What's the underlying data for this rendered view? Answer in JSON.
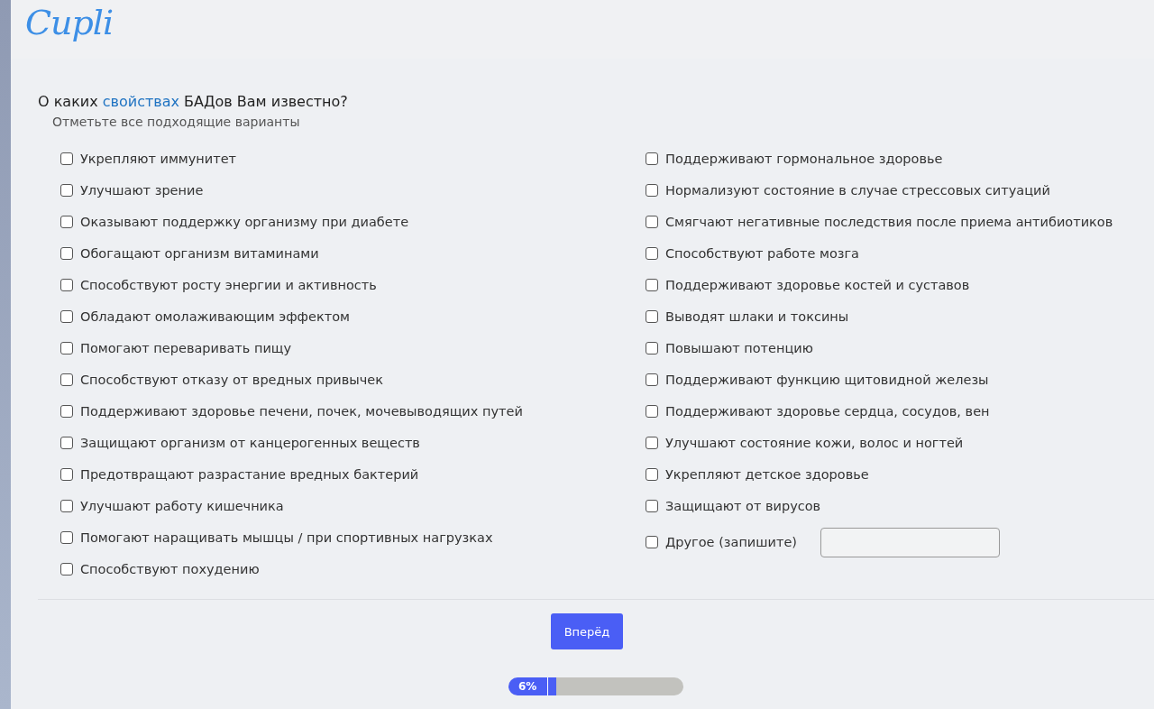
{
  "logo": "Cupli",
  "question": {
    "before": "О каких ",
    "highlight": "свойствах",
    "after": " БАДов Вам известно?",
    "hint": "Отметьте все подходящие варианты"
  },
  "options_left": [
    {
      "label": "Укрепляют иммунитет",
      "checked": false
    },
    {
      "label": "Улучшают зрение",
      "checked": false
    },
    {
      "label": "Оказывают поддержку организму при диабете",
      "checked": false
    },
    {
      "label": "Обогащают организм витаминами",
      "checked": false
    },
    {
      "label": "Способствуют росту энергии и активность",
      "checked": false
    },
    {
      "label": "Обладают омолаживающим эффектом",
      "checked": false
    },
    {
      "label": "Помогают переваривать пищу",
      "checked": false
    },
    {
      "label": "Способствуют отказу от вредных привычек",
      "checked": false
    },
    {
      "label": "Поддерживают здоровье печени, почек, мочевыводящих путей",
      "checked": false
    },
    {
      "label": "Защищают организм от канцерогенных веществ",
      "checked": false
    },
    {
      "label": "Предотвращают разрастание вредных бактерий",
      "checked": false
    },
    {
      "label": "Улучшают работу кишечника",
      "checked": false
    },
    {
      "label": "Помогают наращивать мышцы / при спортивных нагрузках",
      "checked": false
    },
    {
      "label": "Способствуют похудению",
      "checked": false
    }
  ],
  "options_right": [
    {
      "label": "Поддерживают гормональное здоровье",
      "checked": false
    },
    {
      "label": "Нормализуют состояние в случае стрессовых ситуаций",
      "checked": false
    },
    {
      "label": "Смягчают негативные последствия после приема антибиотиков",
      "checked": false
    },
    {
      "label": "Способствуют работе мозга",
      "checked": false
    },
    {
      "label": "Поддерживают здоровье костей и суставов",
      "checked": false
    },
    {
      "label": "Выводят шлаки и токсины",
      "checked": false
    },
    {
      "label": "Повышают потенцию",
      "checked": false
    },
    {
      "label": "Поддерживают функцию щитовидной железы",
      "checked": false
    },
    {
      "label": "Поддерживают здоровье сердца, сосудов, вен",
      "checked": false
    },
    {
      "label": "Улучшают состояние кожи, волос и ногтей",
      "checked": false
    },
    {
      "label": "Укрепляют детское здоровье",
      "checked": false
    },
    {
      "label": "Защищают от вирусов",
      "checked": false
    }
  ],
  "other": {
    "label": "Другое (запишите)",
    "checked": false
  },
  "next_button": "Вперёд",
  "progress": {
    "level": 0.06,
    "label": "6%"
  }
}
